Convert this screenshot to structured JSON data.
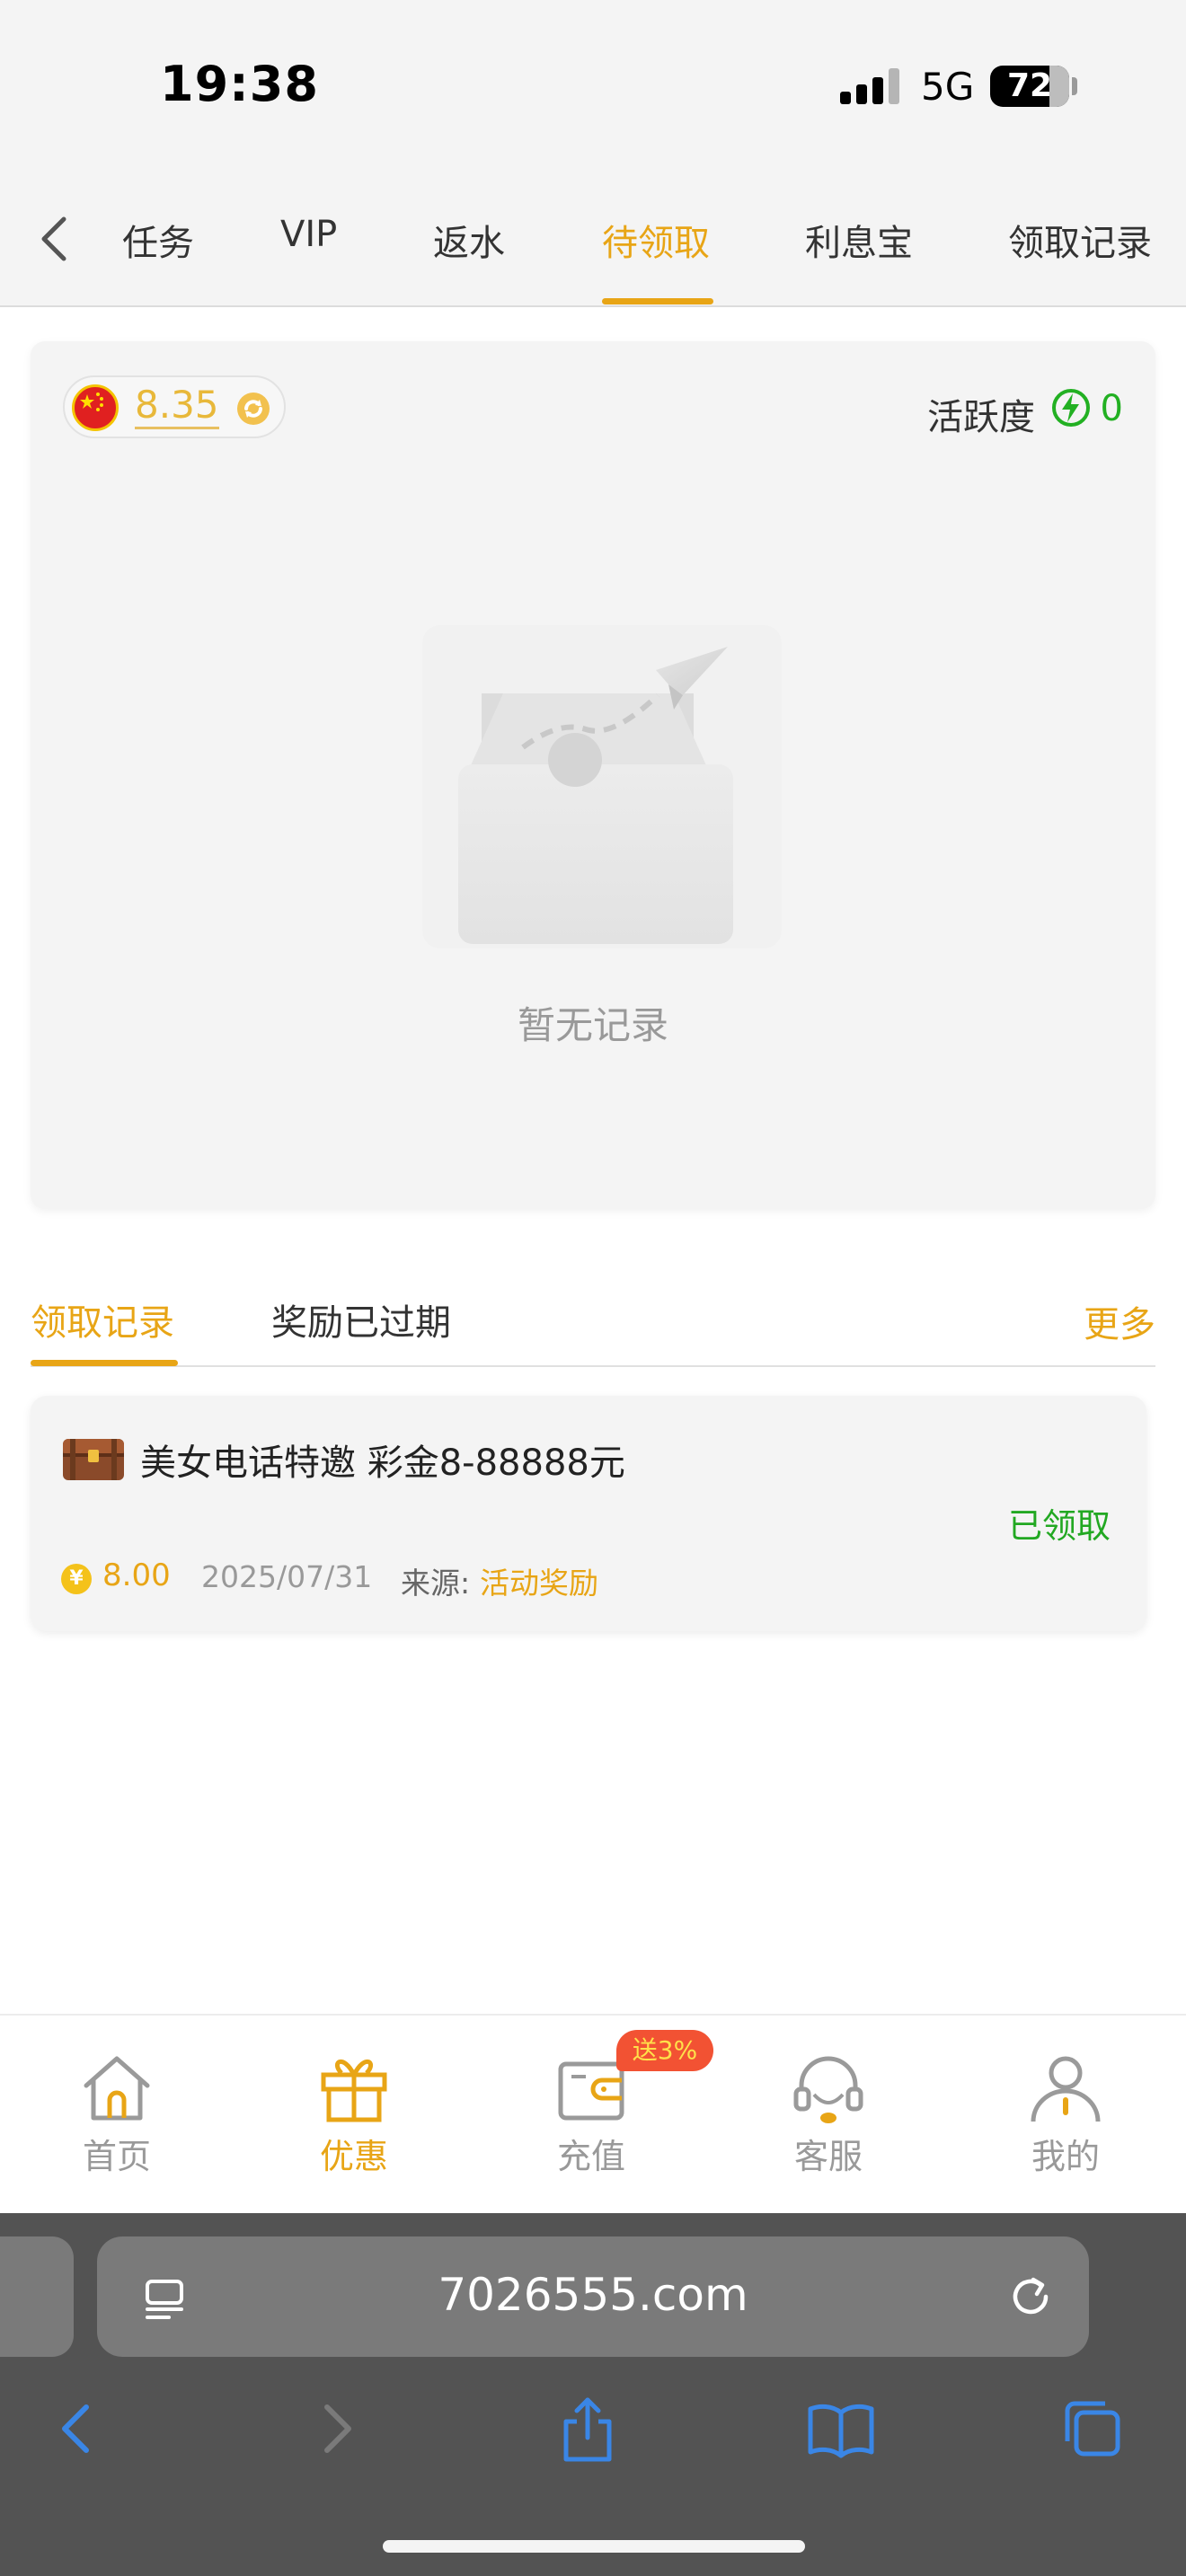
{
  "status_bar": {
    "time": "19:38",
    "network": "5G",
    "battery": "72"
  },
  "top_tabs": {
    "items": [
      "任务",
      "VIP",
      "返水",
      "待领取",
      "利息宝",
      "领取记录"
    ],
    "active_index": 3
  },
  "main_card": {
    "balance": "8.35",
    "activity_label": "活跃度",
    "activity_value": "0",
    "empty_text": "暂无记录"
  },
  "sub_tabs": {
    "items": [
      "领取记录",
      "奖励已过期"
    ],
    "more": "更多"
  },
  "record": {
    "title": "美女电话特邀 彩金8-88888元",
    "status": "已领取",
    "amount": "8.00",
    "date": "2025/07/31",
    "source_label": "来源:",
    "source": "活动奖励"
  },
  "bottom_nav": {
    "items": [
      "首页",
      "优惠",
      "充值",
      "客服",
      "我的"
    ],
    "active_index": 1,
    "promo_badge": "送3%"
  },
  "browser": {
    "url": "7026555.com"
  },
  "colors": {
    "accent": "#e8a516",
    "success": "#22a822",
    "badge": "#f25233"
  }
}
